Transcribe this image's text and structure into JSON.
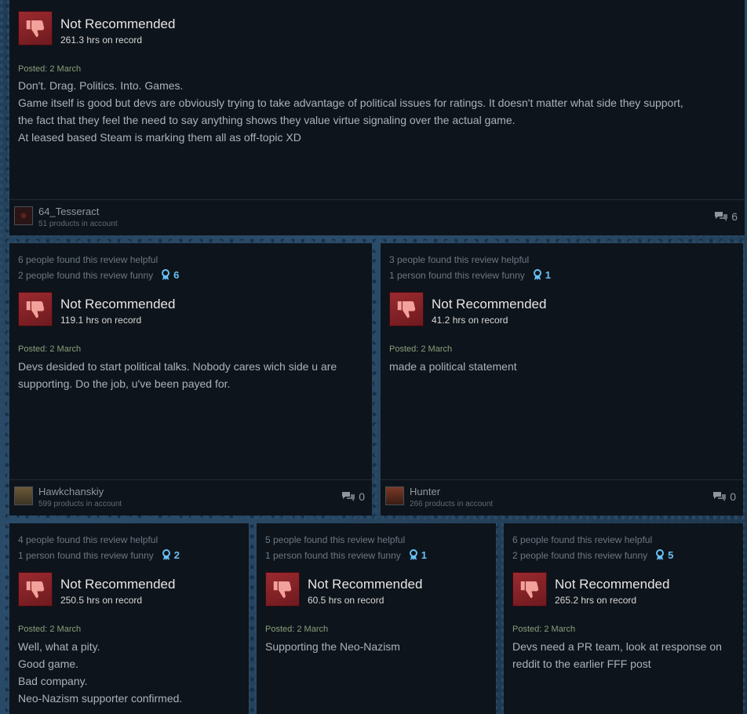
{
  "colors": {
    "accent": "#66c0f4",
    "card_bg": "#0e141b",
    "thumb_red": "#9a2a2f",
    "posted_green": "#8a9f7c"
  },
  "reviews": [
    {
      "helpful": "",
      "funny": "",
      "awards": "",
      "rating": "Not Recommended",
      "hours": "261.3 hrs on record",
      "posted": "Posted: 2 March",
      "lines": [
        "Don't. Drag. Politics. Into. Games.",
        "Game itself is good but devs are obviously trying to take advantage of political issues for ratings. It doesn't matter what side they support,",
        "the fact that they feel the need to say anything shows they value virtue signaling over the actual game.",
        "At leased based Steam is marking them all as off-topic XD"
      ],
      "username": "64_Tesseract",
      "products": "51 products in account",
      "comments": "6"
    },
    {
      "helpful": "6 people found this review helpful",
      "funny": "2 people found this review funny",
      "awards": "6",
      "rating": "Not Recommended",
      "hours": "119.1 hrs on record",
      "posted": "Posted: 2 March",
      "lines": [
        "Devs desided to start political talks. Nobody cares wich side u are",
        "supporting. Do the job, u've been payed for."
      ],
      "username": "Hawkchanskiy",
      "products": "599 products in account",
      "comments": "0"
    },
    {
      "helpful": "3 people found this review helpful",
      "funny": "1 person found this review funny",
      "awards": "1",
      "rating": "Not Recommended",
      "hours": "41.2 hrs on record",
      "posted": "Posted: 2 March",
      "lines": [
        "made a political statement"
      ],
      "username": "Hunter",
      "products": "266 products in account",
      "comments": "0"
    },
    {
      "helpful": "4 people found this review helpful",
      "funny": "1 person found this review funny",
      "awards": "2",
      "rating": "Not Recommended",
      "hours": "250.5 hrs on record",
      "posted": "Posted: 2 March",
      "lines": [
        "Well, what a pity.",
        "Good game.",
        "Bad company.",
        "Neo-Nazism supporter confirmed."
      ]
    },
    {
      "helpful": "5 people found this review helpful",
      "funny": "1 person found this review funny",
      "awards": "1",
      "rating": "Not Recommended",
      "hours": "60.5 hrs on record",
      "posted": "Posted: 2 March",
      "lines": [
        "Supporting the Neo-Nazism"
      ]
    },
    {
      "helpful": "6 people found this review helpful",
      "funny": "2 people found this review funny",
      "awards": "5",
      "rating": "Not Recommended",
      "hours": "265.2 hrs on record",
      "posted": "Posted: 2 March",
      "lines": [
        "Devs need a PR team, look at response on",
        "reddit to the earlier FFF post"
      ]
    }
  ]
}
